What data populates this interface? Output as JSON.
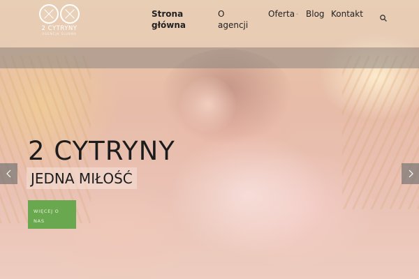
{
  "brand": {
    "name": "2 CYTRYNY",
    "tagline": "AGENCJA ŚLUBNA"
  },
  "nav": {
    "home_line1": "Strona",
    "home_line2": "główna",
    "about": "O agencji",
    "offer": "Oferta",
    "blog": "Blog",
    "contact": "Kontakt",
    "caret": "⌄"
  },
  "slide": {
    "title": "2 CYTRYNY",
    "subtitle": "JEDNA MIŁOŚĆ",
    "button_line1": "WIĘCEJ O",
    "button_line2": "NAS"
  },
  "icons": {
    "search": "search-icon",
    "prev": "chevron-left-icon",
    "next": "chevron-right-icon"
  },
  "colors": {
    "button_bg": "#6aa84f",
    "text": "#1c1c1c",
    "arrow_bg": "#6e6e6e"
  }
}
